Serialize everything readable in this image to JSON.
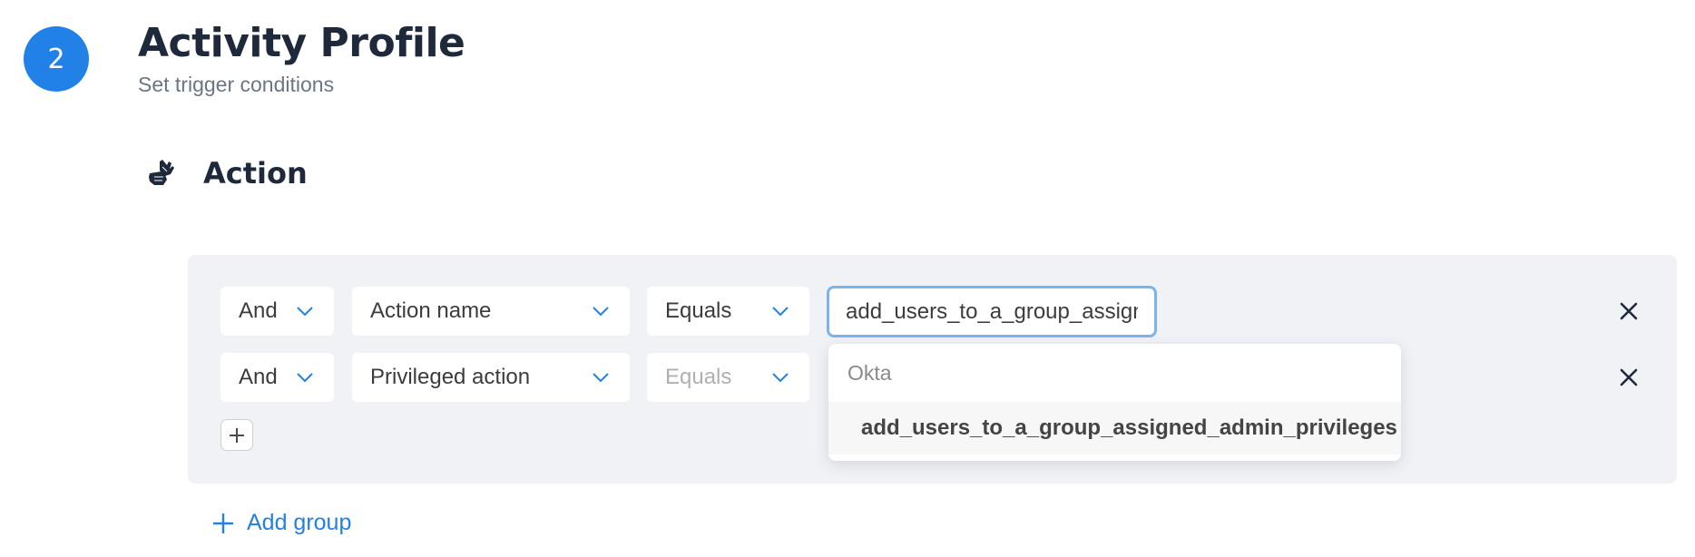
{
  "step": {
    "number": "2",
    "title": "Activity Profile",
    "subtitle": "Set trigger conditions"
  },
  "section": {
    "icon": "sign-language-hands-icon",
    "title": "Action"
  },
  "conditions": [
    {
      "operator": "And",
      "field": "Action name",
      "comparator": "Equals",
      "comparator_disabled": false,
      "value": "add_users_to_a_group_assigned_admin_privileges"
    },
    {
      "operator": "And",
      "field": "Privileged action",
      "comparator": "Equals",
      "comparator_disabled": true,
      "value": ""
    }
  ],
  "dropdown": {
    "group_label": "Okta",
    "options": [
      "add_users_to_a_group_assigned_admin_privileges"
    ]
  },
  "add_condition_label": "+",
  "add_group_label": "Add group",
  "colors": {
    "accent": "#2281e6",
    "panel_bg": "#f0f2f6",
    "heading": "#1e2a3b",
    "focus_border": "#7ab4ee"
  }
}
